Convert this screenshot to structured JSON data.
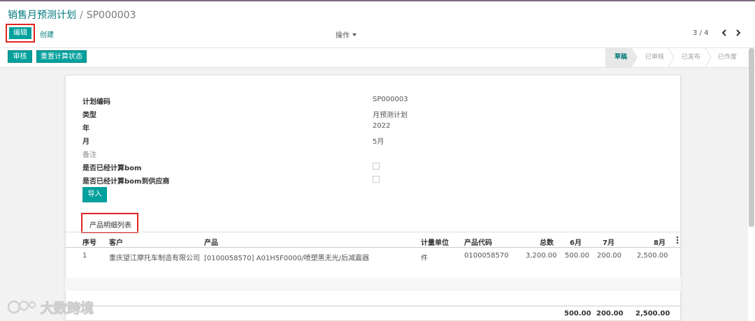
{
  "breadcrumb": {
    "parent": "销售月预测计划",
    "separator": "/",
    "current": "SP000003"
  },
  "toolbar": {
    "edit_label": "编辑",
    "create_label": "创建",
    "action_label": "操作",
    "pager": "3 / 4"
  },
  "statusbar": {
    "approve_label": "审核",
    "recalc_label": "重置计算状态",
    "stages": [
      {
        "label": "草稿",
        "active": true
      },
      {
        "label": "已审核",
        "active": false
      },
      {
        "label": "已发布",
        "active": false
      },
      {
        "label": "已作废",
        "active": false
      }
    ]
  },
  "form": {
    "plan_code_label": "计划编码",
    "plan_code": "SP000003",
    "type_label": "类型",
    "type": "月预测计划",
    "year_label": "年",
    "year": "2022",
    "month_label": "月",
    "month": "5月",
    "remark_label": "备注",
    "bom_calc_label": "是否已经计算bom",
    "bom_calc": false,
    "bom_supplier_label": "是否已经计算bom到供应商",
    "bom_supplier": false,
    "import_label": "导入"
  },
  "tabs": {
    "product_detail": "产品明细列表"
  },
  "table": {
    "headers": {
      "seq": "序号",
      "customer": "客户",
      "product": "产品",
      "uom": "计量单位",
      "code": "产品代码",
      "total": "总数",
      "m6": "6月",
      "m7": "7月",
      "m8": "8月"
    },
    "rows": [
      {
        "seq": "1",
        "customer": "重庆望江摩托车制造有限公司",
        "product": "[0100058570] A01H5F0000/喷塑黑无光/后减震器",
        "uom": "件",
        "code": "0100058570",
        "total": "3,200.00",
        "m6": "500.00",
        "m7": "200.00",
        "m8": "2,500.00"
      }
    ],
    "footer": {
      "m6": "500.00",
      "m7": "200.00",
      "m8": "2,500.00"
    }
  },
  "watermark": {
    "text": "大数跨境"
  },
  "colors": {
    "primary": "#00a09d",
    "link": "#00787c",
    "highlight": "#e02424"
  }
}
